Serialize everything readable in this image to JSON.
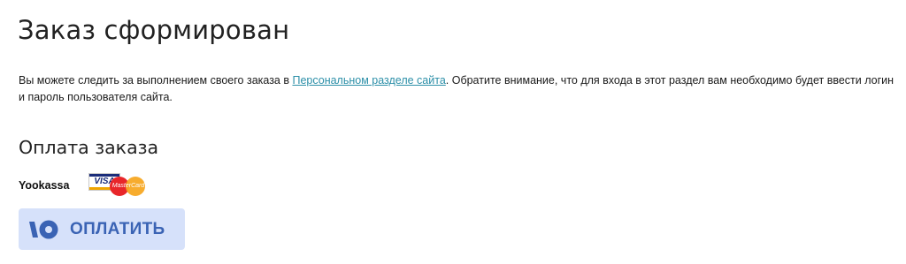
{
  "order": {
    "title": "Заказ сформирован",
    "info_before_link": "Вы можете следить за выполнением своего заказа в ",
    "info_link": "Персональном разделе сайта",
    "info_after_link": ". Обратите внимание, что для входа в этот раздел вам необходимо будет ввести логин и пароль пользователя сайта."
  },
  "payment": {
    "title": "Оплата заказа",
    "system_name": "Yookassa",
    "card_logos": {
      "visa": "VISA",
      "mastercard": "MasterCard"
    },
    "pay_button_label": "ОПЛАТИТЬ",
    "pay_button_icon": "yoomoney-logo-icon"
  },
  "colors": {
    "link": "#2c8fa8",
    "button_bg": "#d6e1fa",
    "button_text": "#3a63b4"
  }
}
